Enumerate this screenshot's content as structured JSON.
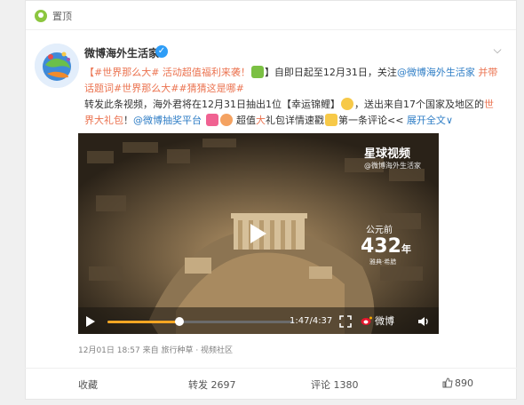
{
  "topbar": {
    "label": "置顶"
  },
  "author": {
    "name": "微博海外生活家"
  },
  "post": {
    "seg1": "【#世界那么大# 活动超值福利来袭！",
    "seg2": "】自即日起至12月31日，关注",
    "seg3": "@微博海外生活家",
    "seg4": " 并带话题词",
    "seg5": "#世界那么大##猜猜这是哪#",
    "seg6": " 转发此条视频，海外君将在12月31日抽出1位【幸运锦鲤】",
    "seg7": "，送出来自17个国家及地区的",
    "seg8": "世界大礼包",
    "seg9": "！",
    "seg10": "@微博抽奖平台",
    "seg11": " ",
    "seg12": " 超值",
    "seg13": "大",
    "seg14": "礼包详情速戳",
    "seg15": "第一条评论<<",
    "expand": "展开全文",
    "expand_chevron": "∨"
  },
  "video": {
    "watermark_title": "星球视频",
    "watermark_sub": "@微博海外生活家",
    "year_prefix": "公元前",
    "year_number": "432",
    "year_suffix": "年",
    "year_sub": "雅典·希腊",
    "time": "1:47/4:37",
    "brand": "微博",
    "progress": 0.386
  },
  "meta": {
    "date": "12月01日 18:57",
    "source_prefix": "来自",
    "source": "旅行种草 · 视频社区"
  },
  "footer": {
    "collect": "收藏",
    "repost": "转发 2697",
    "comment": "评论 1380",
    "like": "890"
  },
  "icons": {
    "pin": "location-pin",
    "verified": "verified-badge",
    "more": "chevron-down",
    "play": "play",
    "fullscreen": "fullscreen",
    "volume": "volume",
    "like": "thumbs-up"
  },
  "colors": {
    "accent": "#eb7350",
    "link": "#2f7ec6",
    "progress": "#f5a623"
  }
}
